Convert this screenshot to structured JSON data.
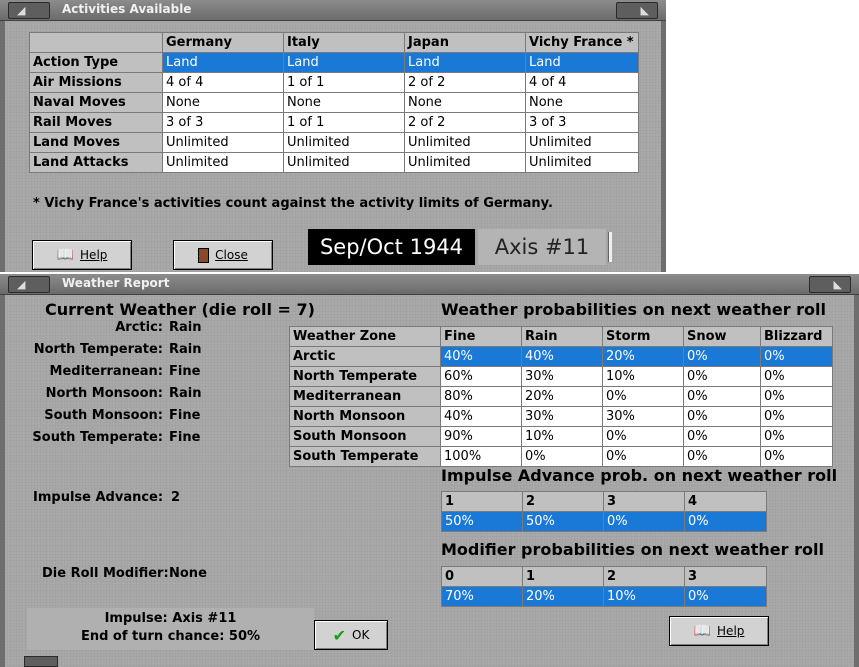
{
  "activities": {
    "title": "Activities Available",
    "columns": [
      "",
      "Germany",
      "Italy",
      "Japan",
      "Vichy France *"
    ],
    "rows": [
      {
        "label": "Action Type",
        "cells": [
          "Land",
          "Land",
          "Land",
          "Land"
        ]
      },
      {
        "label": "Air Missions",
        "cells": [
          "4 of 4",
          "1 of 1",
          "2 of 2",
          "4 of 4"
        ]
      },
      {
        "label": "Naval Moves",
        "cells": [
          "None",
          "None",
          "None",
          "None"
        ]
      },
      {
        "label": "Rail Moves",
        "cells": [
          "3 of 3",
          "1 of 1",
          "2 of 2",
          "3 of 3"
        ]
      },
      {
        "label": "Land Moves",
        "cells": [
          "Unlimited",
          "Unlimited",
          "Unlimited",
          "Unlimited"
        ]
      },
      {
        "label": "Land Attacks",
        "cells": [
          "Unlimited",
          "Unlimited",
          "Unlimited",
          "Unlimited"
        ]
      }
    ],
    "selected_row": 0,
    "footnote": "* Vichy France's activities count against the activity limits of Germany.",
    "help_label": "Help",
    "close_label": "Close",
    "date": "Sep/Oct 1944",
    "impulse": "Axis #11"
  },
  "weather": {
    "title": "Weather Report",
    "current_title": "Current Weather (die roll = 7)",
    "zones": [
      {
        "name": "Arctic:",
        "value": "Rain"
      },
      {
        "name": "North Temperate:",
        "value": "Rain"
      },
      {
        "name": "Mediterranean:",
        "value": "Fine"
      },
      {
        "name": "North Monsoon:",
        "value": "Rain"
      },
      {
        "name": "South Monsoon:",
        "value": "Fine"
      },
      {
        "name": "South Temperate:",
        "value": "Fine"
      }
    ],
    "impulse_advance_label": "Impulse Advance:",
    "impulse_advance_value": "2",
    "die_mod_label": "Die Roll Modifier:",
    "die_mod_value": "None",
    "status_impulse": "Impulse: Axis #11",
    "status_end": "End of turn chance: 50%",
    "ok_label": "OK",
    "help_label": "Help",
    "prob_title": "Weather probabilities on next weather roll",
    "prob_columns": [
      "Weather Zone",
      "Fine",
      "Rain",
      "Storm",
      "Snow",
      "Blizzard"
    ],
    "prob_rows": [
      {
        "zone": "Arctic",
        "cells": [
          "40%",
          "40%",
          "20%",
          "0%",
          "0%"
        ]
      },
      {
        "zone": "North Temperate",
        "cells": [
          "60%",
          "30%",
          "10%",
          "0%",
          "0%"
        ]
      },
      {
        "zone": "Mediterranean",
        "cells": [
          "80%",
          "20%",
          "0%",
          "0%",
          "0%"
        ]
      },
      {
        "zone": "North Monsoon",
        "cells": [
          "40%",
          "30%",
          "30%",
          "0%",
          "0%"
        ]
      },
      {
        "zone": "South Monsoon",
        "cells": [
          "90%",
          "10%",
          "0%",
          "0%",
          "0%"
        ]
      },
      {
        "zone": "South Temperate",
        "cells": [
          "100%",
          "0%",
          "0%",
          "0%",
          "0%"
        ]
      }
    ],
    "prob_selected": 0,
    "impulse_title": "Impulse Advance prob. on next weather roll",
    "impulse_columns": [
      "1",
      "2",
      "3",
      "4"
    ],
    "impulse_values": [
      "50%",
      "50%",
      "0%",
      "0%"
    ],
    "mod_title": "Modifier probabilities on next weather roll",
    "mod_columns": [
      "0",
      "1",
      "2",
      "3"
    ],
    "mod_values": [
      "70%",
      "20%",
      "10%",
      "0%"
    ]
  },
  "colors": {
    "selection": "#1a78d6",
    "frame": "#6e6e6e",
    "panel": "#a8a8a8",
    "header_cell": "#c0c0c0",
    "date_bg": "#000000"
  },
  "icons": {
    "help": "book-icon",
    "close": "door-icon",
    "ok": "checkmark-icon"
  }
}
